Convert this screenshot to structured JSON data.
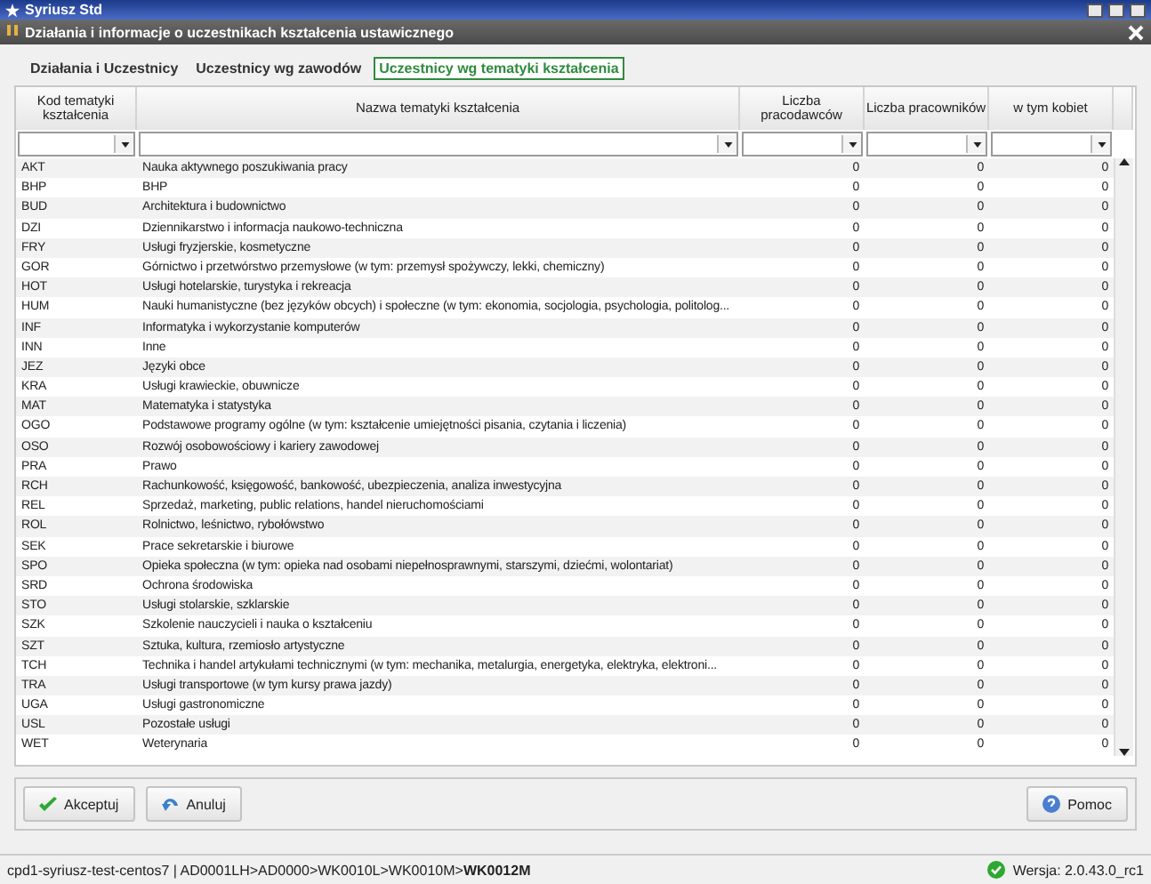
{
  "window": {
    "title": "Syriusz Std"
  },
  "dialog": {
    "title": "Działania i informacje o uczestnikach kształcenia ustawicznego"
  },
  "tabs": [
    {
      "label": "Działania i Uczestnicy",
      "selected": false
    },
    {
      "label": "Uczestnicy wg zawodów",
      "selected": false
    },
    {
      "label": "Uczestnicy wg tematyki kształcenia",
      "selected": true
    }
  ],
  "table": {
    "columns": [
      {
        "label": "Kod tematyki kształcenia"
      },
      {
        "label": "Nazwa tematyki kształcenia"
      },
      {
        "label": "Liczba pracodawców"
      },
      {
        "label": "Liczba pracowników"
      },
      {
        "label": "w tym kobiet"
      }
    ],
    "rows": [
      [
        "AKT",
        "Nauka aktywnego poszukiwania pracy",
        "0",
        "0",
        "0"
      ],
      [
        "BHP",
        "BHP",
        "0",
        "0",
        "0"
      ],
      [
        "BUD",
        "Architektura i budownictwo",
        "0",
        "0",
        "0"
      ],
      [
        "DZI",
        "Dziennikarstwo i informacja naukowo-techniczna",
        "0",
        "0",
        "0"
      ],
      [
        "FRY",
        "Usługi fryzjerskie, kosmetyczne",
        "0",
        "0",
        "0"
      ],
      [
        "GOR",
        "Górnictwo i przetwórstwo przemysłowe (w tym: przemysł spożywczy, lekki, chemiczny)",
        "0",
        "0",
        "0"
      ],
      [
        "HOT",
        "Usługi hotelarskie, turystyka i rekreacja",
        "0",
        "0",
        "0"
      ],
      [
        "HUM",
        "Nauki humanistyczne (bez języków obcych) i społeczne (w tym: ekonomia, socjologia, psychologia, politolog...",
        "0",
        "0",
        "0"
      ],
      [
        "INF",
        "Informatyka i wykorzystanie komputerów",
        "0",
        "0",
        "0"
      ],
      [
        "INN",
        "Inne",
        "0",
        "0",
        "0"
      ],
      [
        "JEZ",
        "Języki obce",
        "0",
        "0",
        "0"
      ],
      [
        "KRA",
        "Usługi krawieckie, obuwnicze",
        "0",
        "0",
        "0"
      ],
      [
        "MAT",
        "Matematyka i statystyka",
        "0",
        "0",
        "0"
      ],
      [
        "OGO",
        "Podstawowe programy ogólne (w tym: kształcenie umiejętności pisania, czytania i liczenia)",
        "0",
        "0",
        "0"
      ],
      [
        "OSO",
        "Rozwój osobowościowy i kariery zawodowej",
        "0",
        "0",
        "0"
      ],
      [
        "PRA",
        "Prawo",
        "0",
        "0",
        "0"
      ],
      [
        "RCH",
        "Rachunkowość, księgowość, bankowość, ubezpieczenia, analiza inwestycyjna",
        "0",
        "0",
        "0"
      ],
      [
        "REL",
        "Sprzedaż, marketing, public relations, handel nieruchomościami",
        "0",
        "0",
        "0"
      ],
      [
        "ROL",
        "Rolnictwo, leśnictwo, rybołówstwo",
        "0",
        "0",
        "0"
      ],
      [
        "SEK",
        "Prace sekretarskie i biurowe",
        "0",
        "0",
        "0"
      ],
      [
        "SPO",
        "Opieka społeczna (w tym: opieka nad osobami niepełnosprawnymi, starszymi, dziećmi, wolontariat)",
        "0",
        "0",
        "0"
      ],
      [
        "SRD",
        "Ochrona środowiska",
        "0",
        "0",
        "0"
      ],
      [
        "STO",
        "Usługi stolarskie, szklarskie",
        "0",
        "0",
        "0"
      ],
      [
        "SZK",
        "Szkolenie nauczycieli i nauka o kształceniu",
        "0",
        "0",
        "0"
      ],
      [
        "SZT",
        "Sztuka, kultura, rzemiosło artystyczne",
        "0",
        "0",
        "0"
      ],
      [
        "TCH",
        "Technika i handel artykułami technicznymi  (w tym: mechanika, metalurgia, energetyka, elektryka, elektroni...",
        "0",
        "0",
        "0"
      ],
      [
        "TRA",
        "Usługi transportowe (w tym kursy prawa jazdy)",
        "0",
        "0",
        "0"
      ],
      [
        "UGA",
        "Usługi gastronomiczne",
        "0",
        "0",
        "0"
      ],
      [
        "USL",
        "Pozostałe usługi",
        "0",
        "0",
        "0"
      ],
      [
        "WET",
        "Weterynaria",
        "0",
        "0",
        "0"
      ]
    ]
  },
  "buttons": [
    {
      "label": "Akceptuj",
      "kind": "accept"
    },
    {
      "label": "Anuluj",
      "kind": "cancel"
    },
    {
      "label": "Pomoc",
      "kind": "help"
    }
  ],
  "status_bar": {
    "path": "cpd1-syriusz-test-centos7 | AD0001LH>AD0000>WK0010L>WK0010M>",
    "current": "WK0012M",
    "version": "Wersja: 2.0.43.0_rc1"
  }
}
